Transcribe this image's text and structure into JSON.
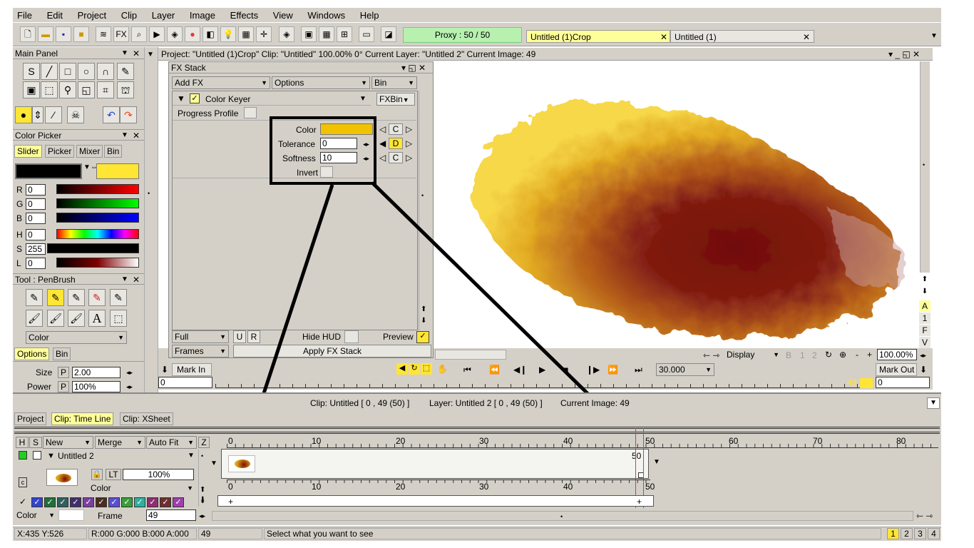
{
  "menu": [
    "File",
    "Edit",
    "Project",
    "Clip",
    "Layer",
    "Image",
    "Effects",
    "View",
    "Windows",
    "Help"
  ],
  "toolbar": {
    "fx_label": "FX",
    "proxy": "Proxy : 50 / 50",
    "tabs": [
      {
        "label": "Untitled (1)Crop",
        "close": "✕"
      },
      {
        "label": "Untitled (1)",
        "close": "✕"
      }
    ]
  },
  "main_panel": {
    "title": "Main Panel"
  },
  "color_picker": {
    "title": "Color Picker",
    "tabs": [
      "Slider",
      "Picker",
      "Mixer",
      "Bin"
    ],
    "channels": [
      {
        "label": "R",
        "value": "0"
      },
      {
        "label": "G",
        "value": "0"
      },
      {
        "label": "B",
        "value": "0"
      },
      {
        "label": "H",
        "value": "0"
      },
      {
        "label": "S",
        "value": "255"
      },
      {
        "label": "L",
        "value": "0"
      }
    ],
    "primary_color": "#000000",
    "secondary_color": "#ffe534"
  },
  "tool_panel": {
    "title": "Tool : PenBrush",
    "mode": "Color",
    "tabs": [
      "Options",
      "Bin"
    ],
    "size_label": "Size",
    "size_p": "P",
    "size_value": "2.00",
    "power_label": "Power",
    "power_p": "P",
    "power_value": "100%"
  },
  "project_bar": "Project: \"Untitled (1)Crop\"  Clip: \"Untitled\"   100.00%   0°  Current Layer: \"Untitled 2\"  Current Image: 49",
  "fx_stack": {
    "title": "FX Stack",
    "add_fx": "Add FX",
    "options": "Options",
    "bin": "Bin",
    "effect_name": "Color Keyer",
    "fxbin": "FXBin",
    "progress_profile": "Progress Profile",
    "params": [
      {
        "label": "Color",
        "value": "",
        "btn": "C"
      },
      {
        "label": "Tolerance",
        "value": "0",
        "btn": "D"
      },
      {
        "label": "Softness",
        "value": "10",
        "btn": "C"
      },
      {
        "label": "Invert",
        "value": "",
        "btn": ""
      }
    ],
    "key_color": "#f2c200",
    "full": "Full",
    "u": "U",
    "r": "R",
    "hide_hud": "Hide HUD",
    "preview": "Preview",
    "frames": "Frames",
    "apply": "Apply FX Stack"
  },
  "viewer": {
    "side_buttons": [
      "A",
      "1",
      "F",
      "V"
    ],
    "display": "Display",
    "zoom": "100.00%",
    "fps": "30.000",
    "mark_in": "Mark In",
    "mark_out": "Mark Out",
    "in_value": "0",
    "out_value": "0",
    "frame_marker": "49",
    "view_num1": "1",
    "view_num2": "2"
  },
  "info_bar": {
    "clip": "Clip: Untitled [ 0 , 49  (50) ]",
    "layer": "Layer: Untitled 2 [ 0 , 49  (50) ]",
    "image": "Current Image: 49"
  },
  "bottom_tabs": [
    "Project",
    "Clip: Time Line",
    "Clip: XSheet"
  ],
  "timeline": {
    "h": "H",
    "s": "S",
    "new": "New",
    "merge": "Merge",
    "autofit": "Auto Fit",
    "z": "Z",
    "layer_name": "Untitled 2",
    "lt": "LT",
    "opacity": "100%",
    "blend": "Color",
    "ruler": [
      "0",
      "10",
      "20",
      "30",
      "40",
      "50",
      "60",
      "70",
      "80"
    ],
    "lower_ruler": [
      "0",
      "10",
      "20",
      "30",
      "40",
      "50"
    ],
    "end_marker": "50",
    "color_mode": "Color",
    "frame_label": "Frame",
    "frame_value": "49",
    "plus": "+"
  },
  "swatches": [
    "#2a2a2a",
    "#3344cc",
    "#1f6f3a",
    "#2f5f5f",
    "#3f2f6f",
    "#7a3f9f",
    "#4a2f1f",
    "#5a4fd0",
    "#3a9f3a",
    "#2fb0a0",
    "#8f2f6f",
    "#6f2f2f",
    "#9f3faf"
  ],
  "status": {
    "coords": "X:435  Y:526",
    "rgba": "R:000 G:000 B:000 A:000",
    "value": "49",
    "message": "Select what you want to see",
    "pages": [
      "1",
      "2",
      "3",
      "4"
    ]
  }
}
